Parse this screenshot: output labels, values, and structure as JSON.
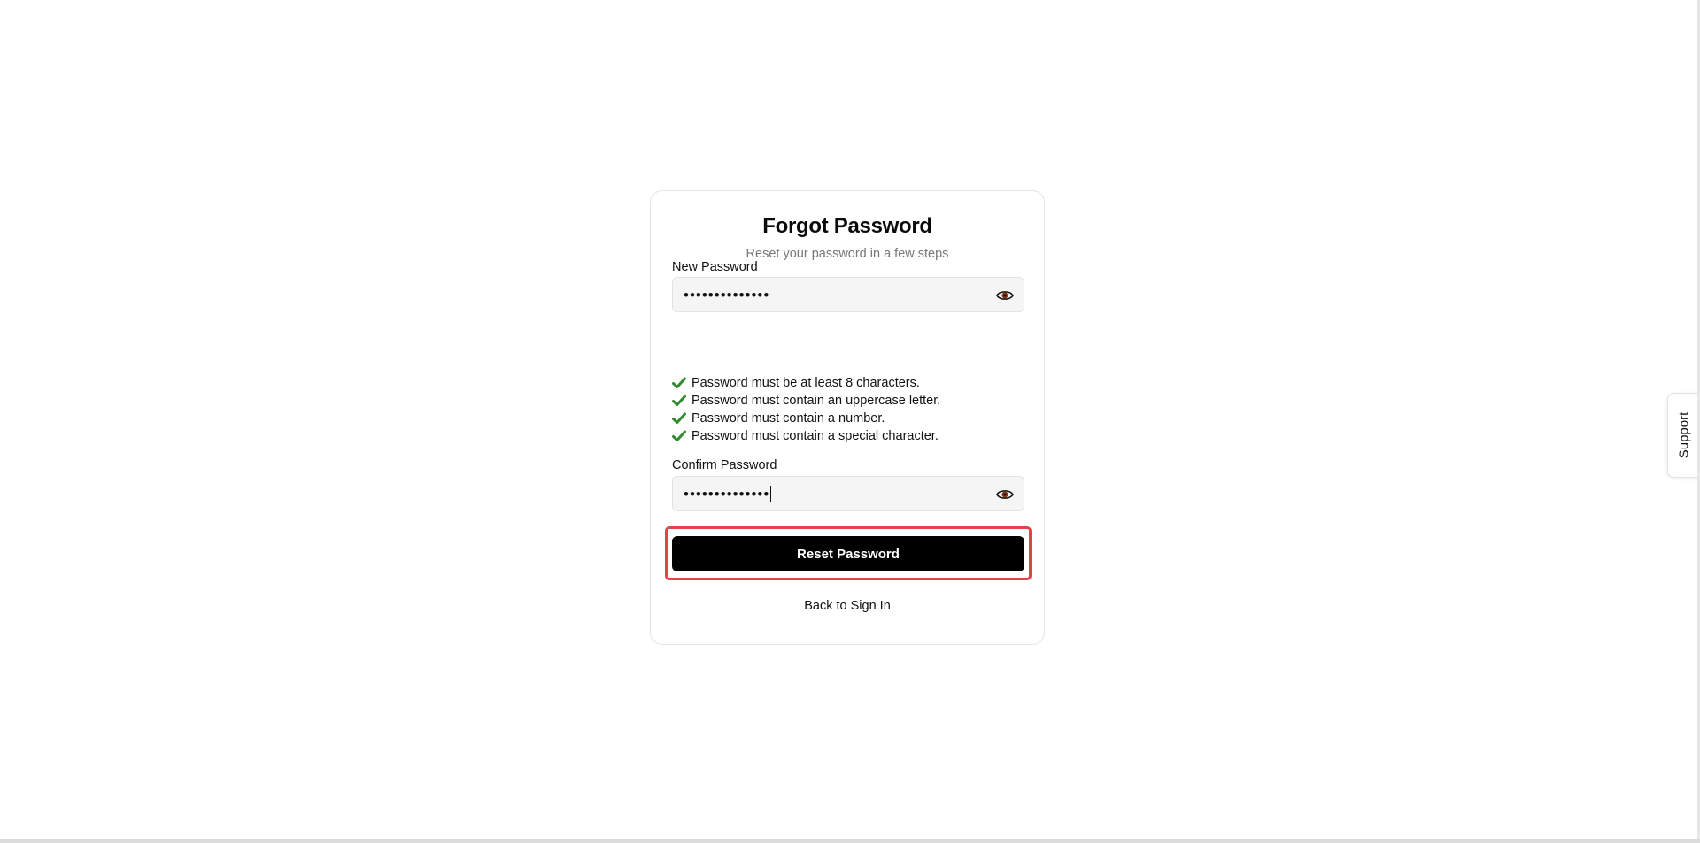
{
  "colors": {
    "accent_button": "#000000",
    "check_green": "#2e8b2e",
    "highlight_border": "#e04545",
    "subtitle_gray": "#777777"
  },
  "form": {
    "title": "Forgot Password",
    "subtitle": "Reset your password in a few steps",
    "new_password": {
      "label": "New Password",
      "value": "••••••••••••••",
      "toggle_icon": "eye-icon"
    },
    "requirements": [
      {
        "text": "Password must be at least 8 characters.",
        "icon": "check-icon",
        "met": true
      },
      {
        "text": "Password must contain an uppercase letter.",
        "icon": "check-icon",
        "met": true
      },
      {
        "text": "Password must contain a number.",
        "icon": "check-icon",
        "met": true
      },
      {
        "text": "Password must contain a special character.",
        "icon": "check-icon",
        "met": true
      }
    ],
    "confirm_password": {
      "label": "Confirm Password",
      "value": "••••••••••••••",
      "toggle_icon": "eye-icon"
    },
    "submit_label": "Reset Password",
    "back_link": "Back to Sign In"
  },
  "support_tab": {
    "label": "Support"
  }
}
